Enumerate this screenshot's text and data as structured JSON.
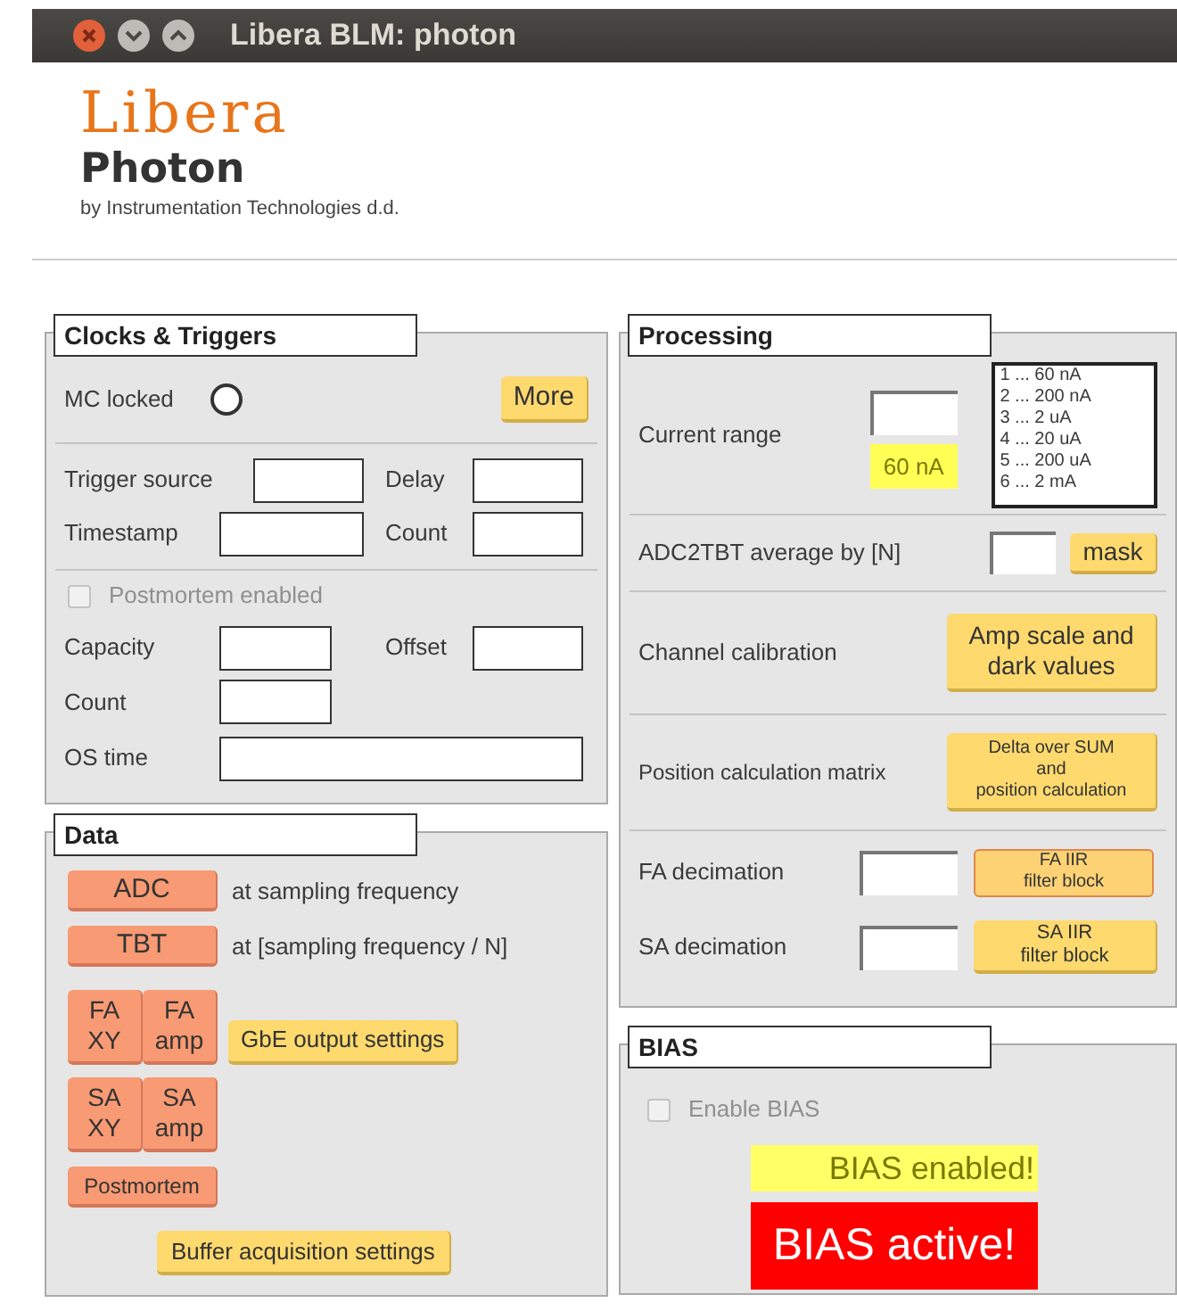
{
  "window": {
    "title": "Libera BLM: photon"
  },
  "header": {
    "logo": "Libera",
    "product": "Photon",
    "tagline": "by Instrumentation Technologies d.d."
  },
  "clocks": {
    "title": "Clocks & Triggers",
    "mc_locked": {
      "label": "MC locked",
      "on": false
    },
    "more_button": "More",
    "trigger_fields": [
      {
        "label": "Trigger source"
      },
      {
        "label": "Delay"
      },
      {
        "label": "Timestamp"
      },
      {
        "label": "Count"
      }
    ],
    "postmortem": {
      "label": "Postmortem enabled",
      "checked": false,
      "disabled": true
    },
    "postmortem_fields": [
      {
        "label": "Capacity"
      },
      {
        "label": "Offset"
      },
      {
        "label": "Count"
      },
      {
        "label": "OS time"
      }
    ]
  },
  "data": {
    "title": "Data",
    "adc": {
      "label": "ADC",
      "note": "at sampling frequency"
    },
    "tbt": {
      "label": "TBT",
      "note": "at [sampling frequency / N]"
    },
    "fa_buttons": [
      "FA XY",
      "FA amp"
    ],
    "gbe_button": "GbE output settings",
    "sa_buttons": [
      "SA XY",
      "SA amp"
    ],
    "postmortem_button": "Postmortem",
    "buffer_button": "Buffer acquisition settings"
  },
  "processing": {
    "title": "Processing",
    "current_range": {
      "label": "Current range",
      "readout": "60 nA",
      "ranges": [
        "1 ... 60 nA",
        "2 ... 200 nA",
        "3 ... 2 uA",
        "4 ... 20 uA",
        "5 ... 200 uA",
        "6 ... 2 mA"
      ]
    },
    "adc2tbt": {
      "label": "ADC2TBT average by [N]",
      "button": "mask"
    },
    "channel_calibration": {
      "label": "Channel calibration",
      "button_lines": [
        "Amp scale and",
        "dark values"
      ]
    },
    "position_matrix": {
      "label": "Position calculation matrix",
      "button_lines": [
        "Delta over SUM",
        "and",
        "position calculation"
      ]
    },
    "fa_decimation": {
      "label": "FA decimation",
      "button_lines": [
        "FA IIR",
        "filter block"
      ]
    },
    "sa_decimation": {
      "label": "SA decimation",
      "button_lines": [
        "SA IIR",
        "filter block"
      ]
    }
  },
  "bias": {
    "title": "BIAS",
    "enable": {
      "label": "Enable BIAS",
      "checked": false,
      "disabled": true
    },
    "status_labels": [
      {
        "text": "BIAS enabled!",
        "color": "#ffff66"
      },
      {
        "text": "BIAS active!",
        "color": "#ff0000"
      }
    ]
  }
}
